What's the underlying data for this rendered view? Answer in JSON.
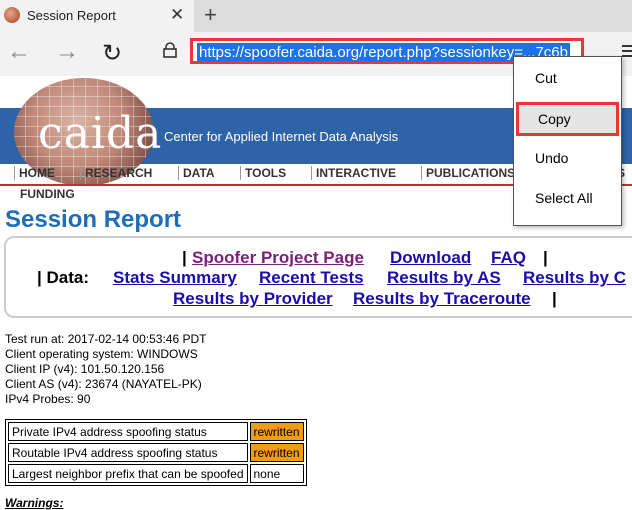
{
  "browser": {
    "tab_title": "Session Report",
    "close_glyph": "✕",
    "new_tab_glyph": "+",
    "back_glyph": "←",
    "forward_glyph": "→",
    "refresh_glyph": "↻",
    "url": "https://spoofer.caida.org/report.php?sessionkey=...7c6b"
  },
  "context_menu": {
    "items": [
      "Cut",
      "Copy",
      "Undo",
      "Select All"
    ]
  },
  "site": {
    "logo": "caida",
    "tagline": "Center for Applied Internet Data Analysis",
    "nav": [
      "HOME",
      "RESEARCH",
      "DATA",
      "TOOLS",
      "INTERACTIVE",
      "PUBLICATIONS",
      "S"
    ],
    "funding": "FUNDING"
  },
  "report": {
    "title": "Session Report",
    "links": {
      "sep": "|",
      "data_label": "| Data:",
      "project_page": "Spoofer Project Page",
      "download": "Download",
      "faq": "FAQ",
      "stats_summary": "Stats Summary",
      "recent_tests": "Recent Tests",
      "results_as": "Results by AS",
      "results_c": "Results by C",
      "results_provider": "Results by Provider",
      "results_traceroute": "Results by Traceroute"
    },
    "info": [
      "Test run at: 2017-02-14 00:53:46 PDT",
      "Client operating system: WINDOWS",
      "Client IP (v4): 101.50.120.156",
      "Client AS (v4): 23674 (NAYATEL-PK)",
      "IPv4 Probes: 90"
    ],
    "table": [
      {
        "label": "Private IPv4 address spoofing status",
        "value": "rewritten"
      },
      {
        "label": "Routable IPv4 address spoofing status",
        "value": "rewritten"
      },
      {
        "label": "Largest neighbor prefix that can be spoofed",
        "value": "none"
      }
    ],
    "warnings_label": "Warnings:"
  },
  "colors": {
    "header_blue": "#2e63a8",
    "title_blue": "#1f6db5",
    "highlight_red": "#e53935",
    "status_orange": "#f39c12"
  }
}
